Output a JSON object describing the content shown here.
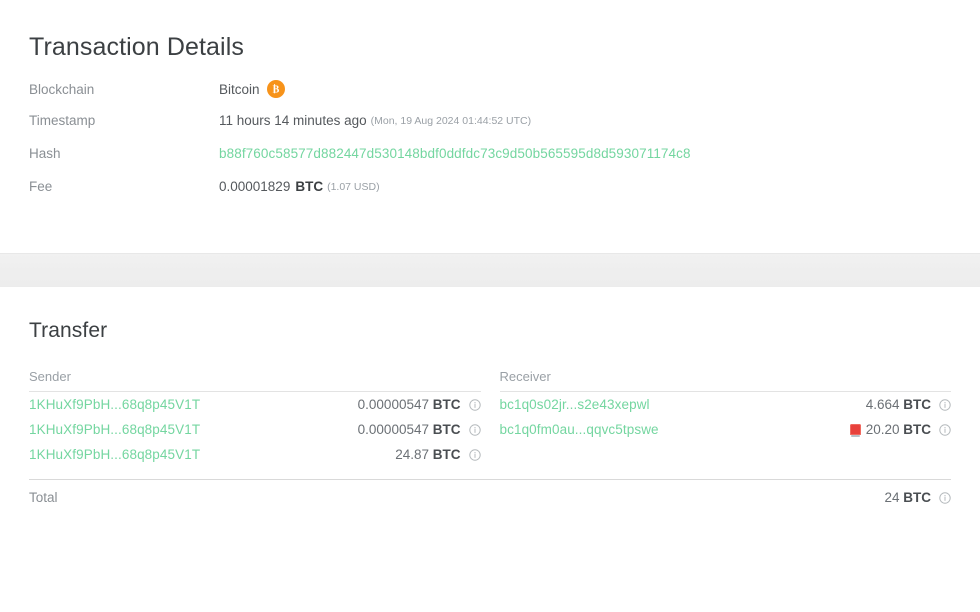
{
  "details": {
    "title": "Transaction Details",
    "rows": [
      {
        "label": "Blockchain",
        "value": "Bitcoin",
        "icon": "bitcoin-logo-icon",
        "icon_color": "#f7931a"
      },
      {
        "label": "Timestamp",
        "value": "11 hours 14 minutes ago",
        "note": "(Mon, 19 Aug 2024 01:44:52 UTC)"
      },
      {
        "label": "Hash",
        "value": "b88f760c58577d882447d530148bdf0ddfdc73c9d50b565595d8d593071174c8",
        "color": "#74d6a0"
      },
      {
        "label": "Fee",
        "amount": "0.00001829",
        "unit": "BTC",
        "note": "(1.07 USD)"
      }
    ]
  },
  "transfer": {
    "title": "Transfer",
    "sender_header": "Sender",
    "receiver_header": "Receiver",
    "senders": [
      {
        "address": "1KHuXf9PbH...68q8p45V1T",
        "amount": "0.00000547",
        "unit": "BTC",
        "info_icon": "info-circle-icon"
      },
      {
        "address": "1KHuXf9PbH...68q8p45V1T",
        "amount": "0.00000547",
        "unit": "BTC",
        "info_icon": "info-circle-icon"
      },
      {
        "address": "1KHuXf9PbH...68q8p45V1T",
        "amount": "24.87",
        "unit": "BTC",
        "info_icon": "info-circle-icon"
      }
    ],
    "receivers": [
      {
        "address": "bc1q0s02jr...s2e43xepwl",
        "amount": "4.664",
        "unit": "BTC",
        "flag": "",
        "info_icon": "info-circle-icon"
      },
      {
        "address": "bc1q0fm0au...qqvc5tpswe",
        "amount": "20.20",
        "unit": "BTC",
        "flag": "alarm-siren-icon",
        "flag_color": "#e8413c",
        "info_icon": "info-circle-icon"
      }
    ],
    "total": {
      "label": "Total",
      "amount": "24",
      "unit": "BTC",
      "info_icon": "info-circle-icon"
    }
  },
  "colors": {
    "link_green": "#74d6a0",
    "bitcoin_orange": "#f7931a",
    "alert_red": "#e8413c",
    "band_gray": "#eeeeee"
  }
}
